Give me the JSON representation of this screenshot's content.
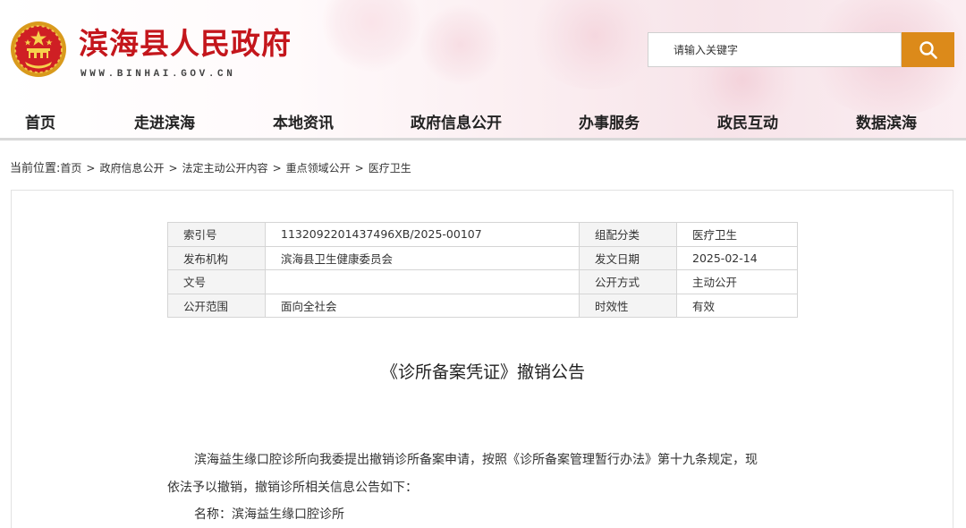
{
  "header": {
    "site_title": "滨海县人民政府",
    "site_url": "WWW.BINHAI.GOV.CN",
    "emblem_icon": "national-emblem-icon",
    "search": {
      "placeholder": "请输入关键字",
      "button_icon": "search-icon",
      "button_color": "#dc8a1a"
    },
    "title_color": "#c4161c"
  },
  "nav": {
    "items": [
      {
        "label": "首页"
      },
      {
        "label": "走进滨海"
      },
      {
        "label": "本地资讯"
      },
      {
        "label": "政府信息公开"
      },
      {
        "label": "办事服务"
      },
      {
        "label": "政民互动"
      },
      {
        "label": "数据滨海"
      }
    ]
  },
  "breadcrumb": {
    "lead": "当前位置:",
    "separator": ">",
    "items": [
      "首页",
      "政府信息公开",
      "法定主动公开内容",
      "重点领域公开",
      "医疗卫生"
    ]
  },
  "meta": {
    "rows": [
      {
        "k1": "索引号",
        "v1": "1132092201437496XB/2025-00107",
        "k2": "组配分类",
        "v2": "医疗卫生"
      },
      {
        "k1": "发布机构",
        "v1": "滨海县卫生健康委员会",
        "k2": "发文日期",
        "v2": "2025-02-14"
      },
      {
        "k1": "文号",
        "v1": "",
        "k2": "公开方式",
        "v2": "主动公开"
      },
      {
        "k1": "公开范围",
        "v1": "面向全社会",
        "k2": "时效性",
        "v2": "有效"
      }
    ]
  },
  "article": {
    "title": "《诊所备案凭证》撤销公告",
    "paragraph1_line1": "滨海益生缘口腔诊所向我委提出撤销诊所备案申请，按照《诊所备案管理暂行办法》第十九条规定，现",
    "paragraph1_line2": "依法予以撤销，撤销诊所相关信息公告如下：",
    "name_line": "名称：滨海益生缘口腔诊所"
  }
}
